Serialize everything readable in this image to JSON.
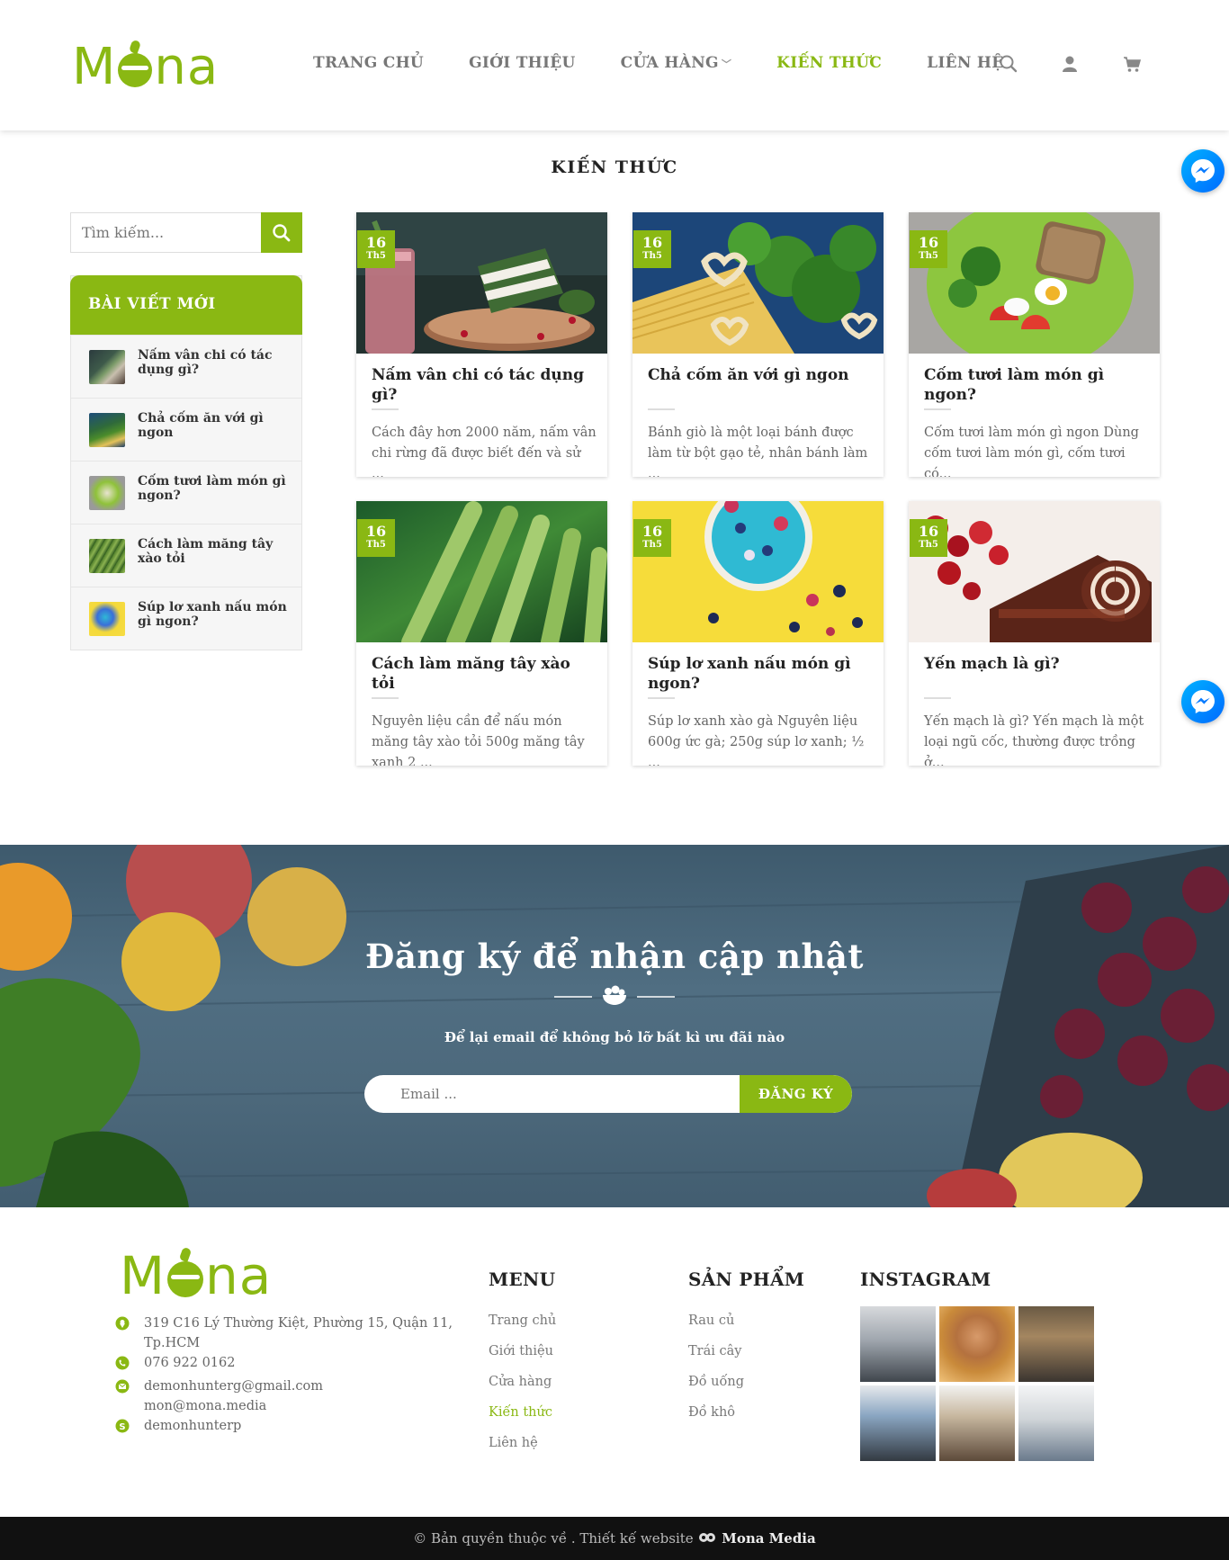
{
  "header": {
    "logo": {
      "pre": "M",
      "post": "na"
    },
    "nav": [
      {
        "label": "TRANG CHỦ"
      },
      {
        "label": "GIỚI THIỆU"
      },
      {
        "label": "CỬA HÀNG"
      },
      {
        "label": "KIẾN THỨC"
      },
      {
        "label": "LIÊN HỆ"
      }
    ],
    "active_nav": "KIẾN THỨC",
    "icons": [
      "search-icon",
      "user-icon",
      "cart-icon"
    ]
  },
  "page_title": "KIẾN THỨC",
  "sidebar": {
    "search_placeholder": "Tìm kiếm...",
    "recent_title": "BÀI VIẾT MỚI",
    "recent": [
      {
        "title": "Nấm vân chi có tác dụng gì?"
      },
      {
        "title": "Chả cốm ăn với gì ngon"
      },
      {
        "title": "Cốm tươi làm món gì ngon?"
      },
      {
        "title": "Cách làm măng tây xào tỏi"
      },
      {
        "title": "Súp lơ xanh nấu món gì ngon?"
      }
    ]
  },
  "posts": [
    {
      "day": "16",
      "month": "Th5",
      "title": "Nấm vân chi có tác dụng gì?",
      "excerpt": "Cách đây hơn 2000 năm, nấm vân chi rừng đã được biết đến và sử ..."
    },
    {
      "day": "16",
      "month": "Th5",
      "title": "Chả cốm ăn với gì ngon",
      "excerpt": "Bánh giò là một loại bánh được làm từ bột gạo tẻ, nhân bánh làm ..."
    },
    {
      "day": "16",
      "month": "Th5",
      "title": "Cốm tươi làm món gì ngon?",
      "excerpt": "Cốm tươi làm món gì ngon Dùng cốm tươi làm món gì, cốm tươi có..."
    },
    {
      "day": "16",
      "month": "Th5",
      "title": "Cách làm măng tây xào tỏi",
      "excerpt": "Nguyên liệu cần để nấu món măng tây xào tỏi 500g măng tây xanh 2 ..."
    },
    {
      "day": "16",
      "month": "Th5",
      "title": "Súp lơ xanh nấu món gì ngon?",
      "excerpt": "Súp lơ xanh xào gà Nguyên liệu 600g ức gà; 250g súp lơ xanh; ½ ..."
    },
    {
      "day": "16",
      "month": "Th5",
      "title": "Yến mạch là gì?",
      "excerpt": "Yến mạch là gì? Yến mạch là một loại ngũ cốc, thường được trồng ở..."
    }
  ],
  "newsletter": {
    "title": "Đăng ký để nhận cập nhật",
    "subtitle": "Để lại email để không bỏ lỡ bất kì ưu đãi nào",
    "email_placeholder": "Email ...",
    "button": "ĐĂNG KÝ"
  },
  "footer": {
    "contact": [
      {
        "icon": "location-icon",
        "text": "319 C16 Lý Thường Kiệt, Phường 15, Quận 11,",
        "text2": "Tp.HCM"
      },
      {
        "icon": "phone-icon",
        "text": "076 922 0162"
      },
      {
        "icon": "mail-icon",
        "text": "demonhunterg@gmail.com",
        "text2": "mon@mona.media"
      },
      {
        "icon": "skype-icon",
        "text": "demonhunterp"
      }
    ],
    "menu_title": "MENU",
    "menu": [
      "Trang chủ",
      "Giới thiệu",
      "Cửa hàng",
      "Kiến thức",
      "Liên hệ"
    ],
    "products_title": "SẢN PHẨM",
    "products": [
      "Rau củ",
      "Trái cây",
      "Đồ uống",
      "Đồ khô"
    ],
    "instagram_title": "INSTAGRAM"
  },
  "copyright": {
    "text": "© Bản quyền thuộc về . Thiết kế website",
    "brand": "Mona Media"
  },
  "colors": {
    "accent": "#8ab813",
    "footer_bar": "#111111"
  }
}
